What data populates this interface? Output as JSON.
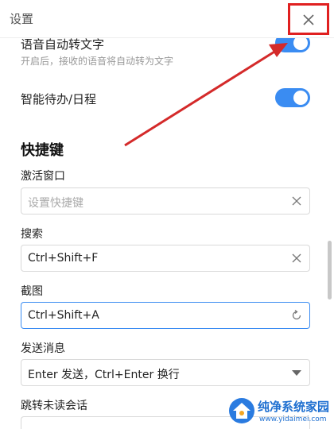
{
  "window": {
    "title": "设置"
  },
  "voice_to_text": {
    "label": "语音自动转文字",
    "description": "开启后，接收的语音将自动转为文字",
    "enabled": true
  },
  "smart_todo": {
    "label": "智能待办/日程",
    "enabled": true
  },
  "shortcuts": {
    "title": "快捷键",
    "activate_window": {
      "label": "激活窗口",
      "placeholder": "设置快捷键",
      "value": ""
    },
    "search": {
      "label": "搜索",
      "value": "Ctrl+Shift+F"
    },
    "screenshot": {
      "label": "截图",
      "value": "Ctrl+Shift+A"
    },
    "send_message": {
      "label": "发送消息",
      "selected": "Enter 发送，Ctrl+Enter 换行"
    },
    "jump_unread": {
      "label": "跳转未读会话"
    }
  },
  "watermark": {
    "brand": "纯净系统家园",
    "url": "www.yidaimei.com"
  },
  "colors": {
    "accent": "#3a8cf2",
    "annotation": "#e02020",
    "watermark": "#1e6fd0"
  }
}
